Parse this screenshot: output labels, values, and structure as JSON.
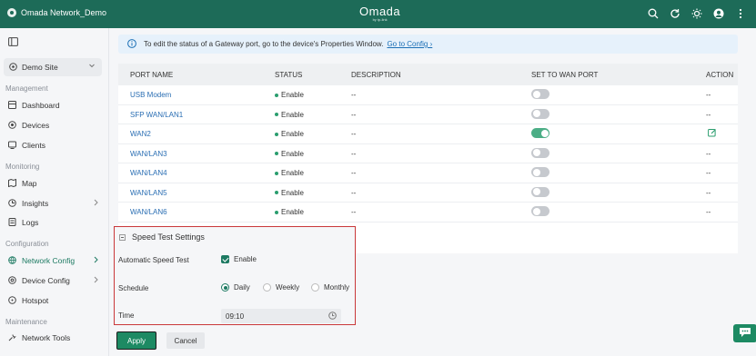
{
  "header": {
    "site_name": "Omada Network_Demo",
    "logo_name": "Omada",
    "logo_sub": "by tp-link",
    "icons": [
      "search-icon",
      "refresh-icon",
      "theme-icon",
      "avatar",
      "more-icon"
    ]
  },
  "sidebar": {
    "site_selector": "Demo Site",
    "sections": {
      "management": "Management",
      "monitoring": "Monitoring",
      "configuration": "Configuration",
      "maintenance": "Maintenance"
    },
    "items": {
      "dashboard": "Dashboard",
      "devices": "Devices",
      "clients": "Clients",
      "map": "Map",
      "insights": "Insights",
      "logs": "Logs",
      "network_config": "Network Config",
      "device_config": "Device Config",
      "hotspot": "Hotspot",
      "network_tools": "Network Tools"
    }
  },
  "banner": {
    "text": "To edit the status of a Gateway port, go to the device's Properties Window.",
    "link": "Go to Config ›"
  },
  "table": {
    "headers": {
      "port_name": "PORT NAME",
      "status": "STATUS",
      "description": "DESCRIPTION",
      "set_wan": "SET TO WAN PORT",
      "action": "ACTION"
    },
    "rows": [
      {
        "port": "USB Modem",
        "status": "Enable",
        "description": "--",
        "wan_on": false,
        "action": "--"
      },
      {
        "port": "SFP WAN/LAN1",
        "status": "Enable",
        "description": "--",
        "wan_on": false,
        "action": "--"
      },
      {
        "port": "WAN2",
        "status": "Enable",
        "description": "--",
        "wan_on": true,
        "action": "edit"
      },
      {
        "port": "WAN/LAN3",
        "status": "Enable",
        "description": "--",
        "wan_on": false,
        "action": "--"
      },
      {
        "port": "WAN/LAN4",
        "status": "Enable",
        "description": "--",
        "wan_on": false,
        "action": "--"
      },
      {
        "port": "WAN/LAN5",
        "status": "Enable",
        "description": "--",
        "wan_on": false,
        "action": "--"
      },
      {
        "port": "WAN/LAN6",
        "status": "Enable",
        "description": "--",
        "wan_on": false,
        "action": "--"
      }
    ]
  },
  "speed_test": {
    "title": "Speed Test Settings",
    "auto_label": "Automatic Speed Test",
    "auto_value": "Enable",
    "schedule_label": "Schedule",
    "schedule_options": [
      "Daily",
      "Weekly",
      "Monthly"
    ],
    "schedule_selected": "Daily",
    "time_label": "Time",
    "time_value": "09:10"
  },
  "buttons": {
    "apply": "Apply",
    "cancel": "Cancel"
  },
  "colors": {
    "header_bg": "#1d6b58",
    "accent": "#1d8a63",
    "link": "#2a6eb3",
    "highlight_border": "#c9383a"
  }
}
